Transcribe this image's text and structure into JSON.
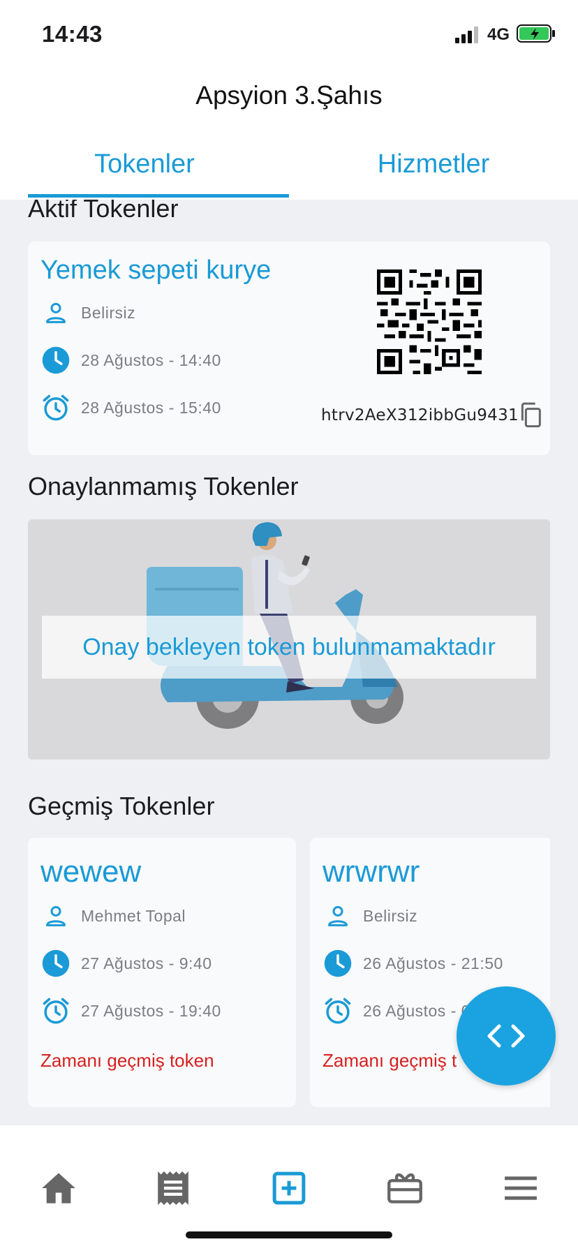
{
  "status_bar": {
    "time": "14:43",
    "network": "4G"
  },
  "header": {
    "title": "Apsyion 3.Şahıs"
  },
  "tabs": [
    {
      "label": "Tokenler",
      "active": true
    },
    {
      "label": "Hizmetler",
      "active": false
    }
  ],
  "active_tokens": {
    "section_title": "Aktif Tokenler",
    "card": {
      "title": "Yemek sepeti kurye",
      "user": "Belirsiz",
      "start": "28 Ağustos - 14:40",
      "end": "28 Ağustos - 15:40",
      "code": "htrv2AeX312ibbGu9431"
    }
  },
  "pending_tokens": {
    "section_title": "Onaylanmamış Tokenler",
    "empty_message": "Onay bekleyen token bulunmamaktadır"
  },
  "past_tokens": {
    "section_title": "Geçmiş Tokenler",
    "cards": [
      {
        "title": "wewew",
        "user": "Mehmet Topal",
        "start": "27 Ağustos - 9:40",
        "end": "27 Ağustos - 19:40",
        "status": "Zamanı geçmiş token"
      },
      {
        "title": "wrwrwr",
        "user": "Belirsiz",
        "start": "26 Ağustos - 21:50",
        "end": "26 Ağustos - 0",
        "status": "Zamanı geçmiş t"
      }
    ]
  },
  "bottom_nav": [
    {
      "icon": "home-icon"
    },
    {
      "icon": "receipt-icon"
    },
    {
      "icon": "add-box-icon",
      "active": true
    },
    {
      "icon": "gift-card-icon"
    },
    {
      "icon": "menu-icon"
    }
  ],
  "colors": {
    "accent": "#1a9ad6",
    "expired": "#d62020",
    "background": "#eef0f3"
  }
}
